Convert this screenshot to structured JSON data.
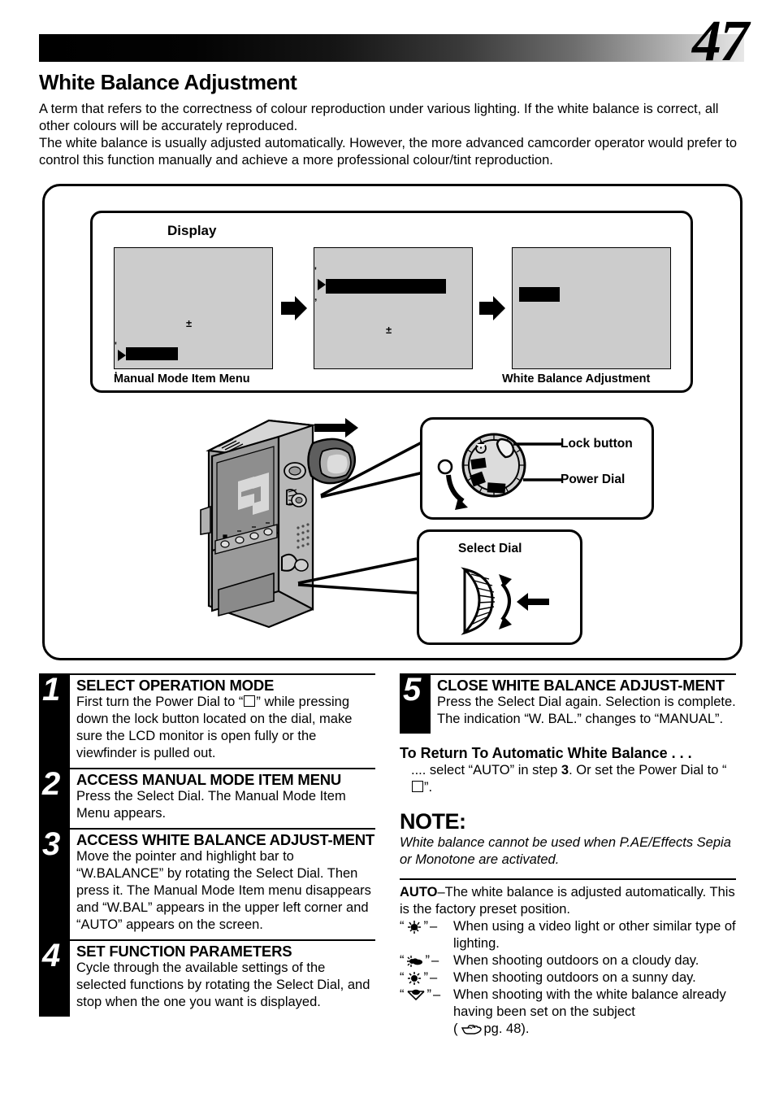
{
  "header": {
    "page_number": "47",
    "title": "White Balance Adjustment",
    "intro_1": "A term that refers to the correctness of colour reproduction under various lighting. If the white balance is correct, all other colours will be accurately reproduced.",
    "intro_2": "The white balance is usually adjusted automatically. However, the more advanced camcorder operator would prefer to control this function manually and achieve a more professional colour/tint reproduction."
  },
  "figure": {
    "display_label": "Display",
    "caption_left": "Manual Mode Item Menu",
    "caption_right": "White Balance Adjustment",
    "lock_button_label": "Lock button",
    "power_dial_label": "Power Dial",
    "select_dial_label": "Select Dial",
    "icons": {
      "arrow": "right-arrow-icon",
      "pointer": "menu-pointer-icon",
      "power": "power-symbol-icon",
      "rotate": "rotate-arrow-icon",
      "press": "press-arrow-icon"
    }
  },
  "steps": [
    {
      "number": "1",
      "heading": "SELECT OPERATION MODE",
      "body_a": "First turn the Power Dial to “",
      "body_b": "” while pressing down the lock button located on the dial, make sure the LCD monitor is open fully or the viewfinder is pulled out."
    },
    {
      "number": "2",
      "heading": "ACCESS MANUAL MODE ITEM MENU",
      "body": "Press the Select Dial. The Manual Mode Item Menu appears."
    },
    {
      "number": "3",
      "heading": "ACCESS WHITE BALANCE ADJUST-MENT",
      "body": "Move the pointer and highlight bar to “W.BALANCE” by rotating the Select Dial. Then press it. The Manual Mode Item menu disappears and “W.BAL” appears in the upper left corner and “AUTO” appears on the screen."
    },
    {
      "number": "4",
      "heading": "SET FUNCTION PARAMETERS",
      "body": "Cycle through the available settings of the selected functions by rotating the Select Dial, and stop when the one you want is displayed."
    },
    {
      "number": "5",
      "heading": "CLOSE WHITE BALANCE ADJUST-MENT",
      "body": "Press the Select Dial again. Selection is complete. The indication “W. BAL.” changes to “MANUAL”."
    }
  ],
  "return_section": {
    "heading": "To Return To Automatic White Balance . . .",
    "body_a": ".... select “AUTO” in step ",
    "body_step": "3",
    "body_b": ". Or set the Power Dial to “",
    "body_c": "”."
  },
  "note": {
    "heading": "NOTE:",
    "body": "White balance cannot be used when P.AE/Effects Sepia or Monotone are activated."
  },
  "legend": {
    "auto_label": "AUTO",
    "auto_text": "–The white balance is adjusted automatically. This is the factory preset position.",
    "items": [
      {
        "icon": "halogen-lamp-icon",
        "dash": "–",
        "text": "When using a video light or other similar type of lighting."
      },
      {
        "icon": "cloudy-sun-icon",
        "dash": "–",
        "text": "When shooting outdoors on a cloudy day."
      },
      {
        "icon": "sunny-sun-icon",
        "dash": "–",
        "text": "When shooting outdoors on a sunny day."
      },
      {
        "icon": "manual-wb-icon",
        "dash": "–",
        "text": "When shooting with the white balance already having been set on the subject"
      }
    ],
    "page_ref_open": "(",
    "page_ref_icon": "pointing-hand-icon",
    "page_ref_text": " pg. 48)."
  },
  "colors": {
    "lcd_grey": "#cccccc",
    "ink": "#000000",
    "paper": "#ffffff"
  }
}
